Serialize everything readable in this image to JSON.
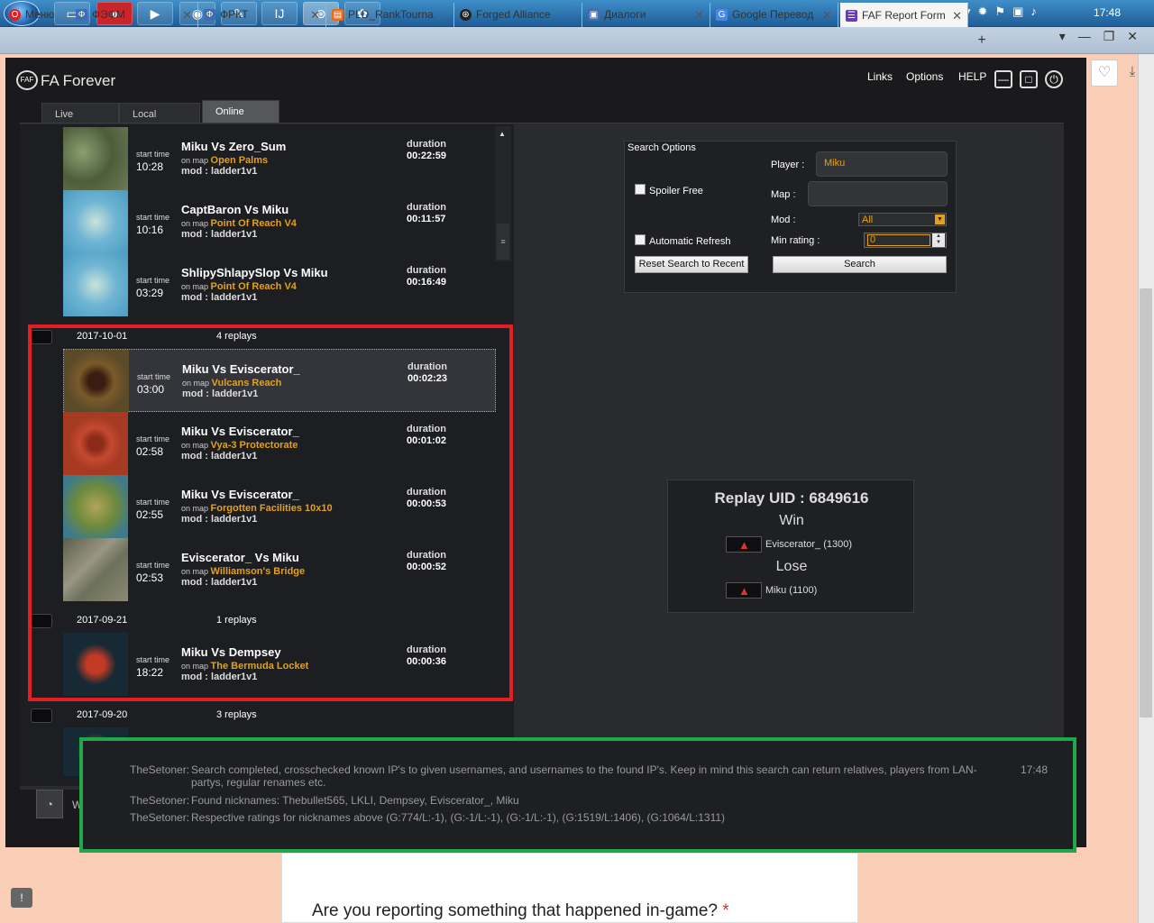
{
  "taskbar": {
    "lang": "EN",
    "clock": "17:48",
    "apps": [
      "explorer",
      "opera",
      "media-player",
      "discord",
      "pdf-reader",
      "intellij",
      "faf-client",
      "paint"
    ]
  },
  "browser": {
    "tabs": [
      {
        "label": "Меню",
        "icon": "opera-icon",
        "color": "#e31e24"
      },
      {
        "label": "ФЭФМ",
        "icon": "vk-icon",
        "color": "#3c6eb4"
      },
      {
        "label": "ФРКТ",
        "icon": "vk-icon",
        "color": "#3c6eb4"
      },
      {
        "label": "PLD_RankTourna",
        "icon": "doc-icon",
        "color": "#e36d1d"
      },
      {
        "label": "Forged Alliance",
        "icon": "faf-icon",
        "color": "#222"
      },
      {
        "label": "Диалоги",
        "icon": "vk-icon",
        "color": "#3c6eb4"
      },
      {
        "label": "Google Перевод",
        "icon": "translate-icon",
        "color": "#4a86e8"
      },
      {
        "label": "FAF Report Form",
        "icon": "form-icon",
        "color": "#673ab7"
      }
    ]
  },
  "faf": {
    "title": "FA Forever",
    "logo": "FAF",
    "menu": [
      "Links",
      "Options",
      "HELP"
    ],
    "tabs": [
      "Live Games",
      "Local Archive",
      "Online Vault"
    ],
    "labels": {
      "start": "start time",
      "duration": "duration",
      "onmap": "on map",
      "mod": "mod :"
    },
    "replays_top": [
      {
        "time": "10:28",
        "title": "Miku Vs Zero_Sum",
        "map": "Open Palms",
        "mod": "ladder1v1",
        "duration": "00:22:59",
        "thumb": "#556b4a"
      },
      {
        "time": "10:16",
        "title": "CaptBaron Vs Miku",
        "map": "Point Of Reach V4",
        "mod": "ladder1v1",
        "duration": "00:11:57",
        "thumb": "#7ab4c9"
      },
      {
        "time": "03:29",
        "title": "ShlipyShlapySlop Vs Miku",
        "map": "Point Of Reach V4",
        "mod": "ladder1v1",
        "duration": "00:16:49",
        "thumb": "#7ab4c9"
      }
    ],
    "groups": [
      {
        "date": "2017-10-01",
        "count": "4 replays",
        "replays": [
          {
            "time": "03:00",
            "title": "Miku Vs Eviscerator_",
            "map": "Vulcans Reach",
            "mod": "ladder1v1",
            "duration": "00:02:23",
            "thumb": "#5a4020"
          },
          {
            "time": "02:58",
            "title": "Miku Vs Eviscerator_",
            "map": "Vya-3 Protectorate",
            "mod": "ladder1v1",
            "duration": "00:01:02",
            "thumb": "#a63a22"
          },
          {
            "time": "02:55",
            "title": "Miku Vs Eviscerator_",
            "map": "Forgotten Facilities 10x10",
            "mod": "ladder1v1",
            "duration": "00:00:53",
            "thumb": "#6c8a3c"
          },
          {
            "time": "02:53",
            "title": "Eviscerator_ Vs Miku",
            "map": "Williamson's Bridge",
            "mod": "ladder1v1",
            "duration": "00:00:52",
            "thumb": "#7e7d6a"
          }
        ]
      },
      {
        "date": "2017-09-21",
        "count": "1 replays",
        "replays": [
          {
            "time": "18:22",
            "title": "Miku Vs Dempsey",
            "map": "The Bermuda Locket",
            "mod": "ladder1v1",
            "duration": "00:00:36",
            "thumb": "#152a35"
          }
        ]
      },
      {
        "date": "2017-09-20",
        "count": "3 replays",
        "replays": []
      }
    ],
    "search": {
      "heading": "Search Options",
      "player_label": "Player :",
      "player_value": "Miku",
      "map_label": "Map :",
      "map_value": "",
      "mod_label": "Mod :",
      "mod_value": "All",
      "min_rating_label": "Min rating :",
      "min_rating_value": "0",
      "spoiler_free": "Spoiler Free",
      "auto_refresh": "Automatic Refresh",
      "reset_button": "Reset Search to Recent",
      "search_button": "Search"
    },
    "replay_info": {
      "uid": "Replay UID : 6849616",
      "win_label": "Win",
      "winner": "Eviscerator_ (1300)",
      "lose_label": "Lose",
      "loser": "Miku (1100)"
    },
    "chat": {
      "time": "17:48",
      "lines": [
        {
          "who": "TheSetoner:",
          "msg": "Search completed, crosschecked known IP's to given usernames, and usernames to the found IP's. Keep in mind this search can return relatives, players from LAN-partys, regular renames etc."
        },
        {
          "who": "TheSetoner:",
          "msg": "Found nicknames: Thebullet565, LKLI, Dempsey, Eviscerator_, Miku"
        },
        {
          "who": "TheSetoner:",
          "msg": "Respective ratings for nicknames above (G:774/L:-1), (G:-1/L:-1), (G:-1/L:-1), (G:1519/L:1406), (G:1064/L:1311)"
        }
      ],
      "hidden_label": "W"
    }
  },
  "form": {
    "question": "Are you reporting something that happened in-game?",
    "required_mark": "*"
  },
  "colors": {
    "map_name": "#e3a01d",
    "red_box": "#e31e24",
    "green_box": "#21a64b"
  }
}
